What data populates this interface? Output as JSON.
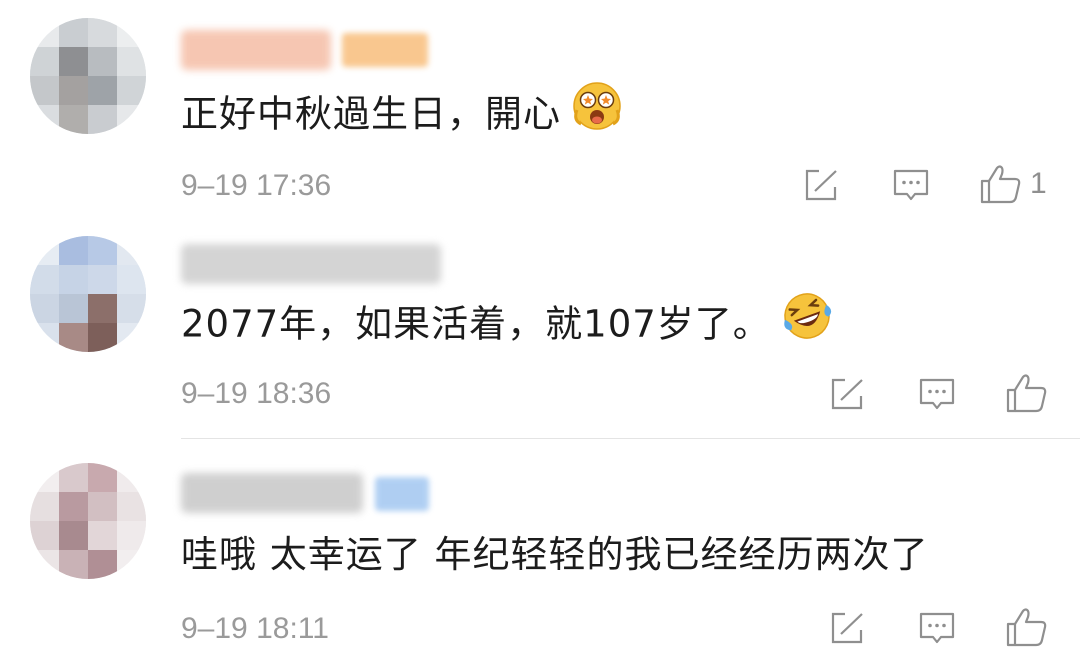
{
  "comments": [
    {
      "text": "正好中秋過生日，開心",
      "emoji": "grinning-emoji",
      "time": "9–19 17:36",
      "likes": "1",
      "badge_color": "#f7b56a"
    },
    {
      "text": "2077年，如果活着，就107岁了。",
      "emoji": "laughing-tears-emoji",
      "time": "9–19 18:36",
      "likes": ""
    },
    {
      "text": "哇哦 太幸运了 年纪轻轻的我已经经历两次了",
      "time": "9–19 18:11",
      "likes": "",
      "badge_color": "#9cc3f0"
    }
  ],
  "icons": {
    "share": "share-icon",
    "reply": "comment-icon",
    "like": "thumbs-up-icon"
  }
}
